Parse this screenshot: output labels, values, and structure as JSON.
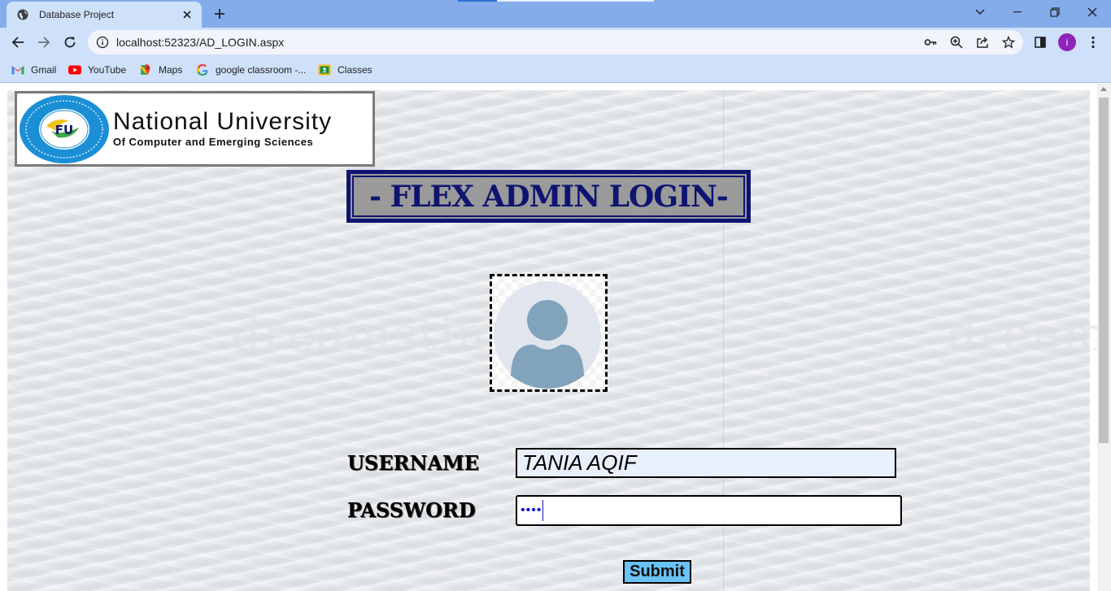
{
  "browser": {
    "tab_title": "Database Project",
    "url": "localhost:52323/AD_LOGIN.aspx",
    "profile_initial": "i",
    "bookmarks": [
      {
        "label": "Gmail",
        "icon": "gmail-icon"
      },
      {
        "label": "YouTube",
        "icon": "youtube-icon"
      },
      {
        "label": "Maps",
        "icon": "maps-icon"
      },
      {
        "label": "google classroom -...",
        "icon": "google-icon"
      },
      {
        "label": "Classes",
        "icon": "classroom-icon"
      }
    ]
  },
  "page": {
    "logo": {
      "name": "National University",
      "subtitle": "Of Computer and Emerging Sciences",
      "seal_text": "FU"
    },
    "heading": "- FLEX ADMIN LOGIN-",
    "watermark": "dreamstime",
    "form": {
      "username_label": "USERNAME",
      "username_value": "TANIA AQIF",
      "password_label": "PASSWORD",
      "password_mask": "••••",
      "submit_label": "Submit"
    }
  },
  "colors": {
    "heading_navy": "#0e1470",
    "heading_bg": "#9a9a9a",
    "submit_bg": "#69c3f5",
    "chrome_tabstrip": "#84acea",
    "chrome_toolbar": "#cfe0fa",
    "avatar_silhouette": "#81a3bb"
  }
}
